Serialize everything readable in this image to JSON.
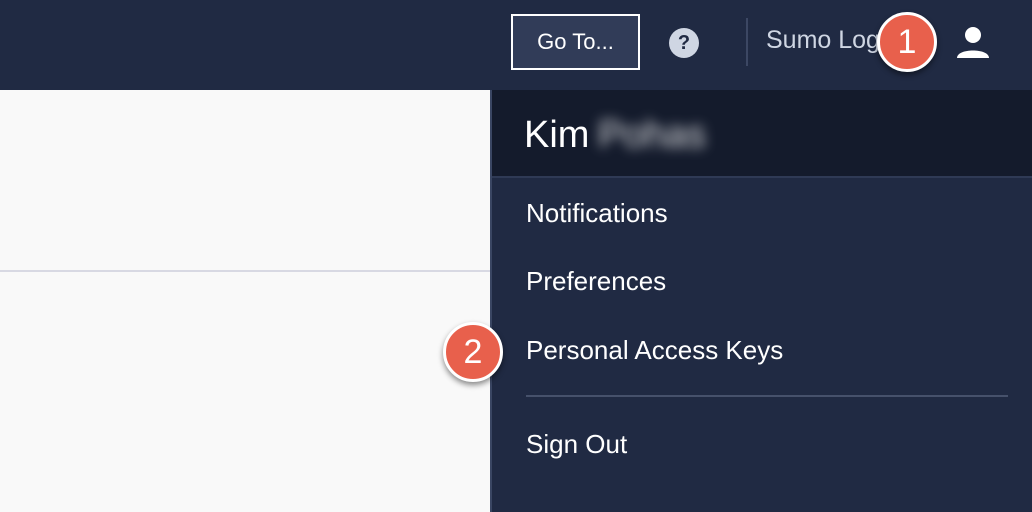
{
  "topbar": {
    "goto_label": "Go To...",
    "help_icon": "question-circle-icon",
    "org_name": "Sumo Logic",
    "user_icon": "user-icon",
    "bg_color": "#202a43"
  },
  "callouts": {
    "badge_1": "1",
    "badge_2": "2",
    "color": "#e8604c"
  },
  "user_menu": {
    "user_first_name": "Kim",
    "user_last_name": "Pohas",
    "items": [
      {
        "label": "Notifications"
      },
      {
        "label": "Preferences"
      },
      {
        "label": "Personal Access Keys"
      },
      {
        "label": "Sign Out"
      }
    ]
  }
}
